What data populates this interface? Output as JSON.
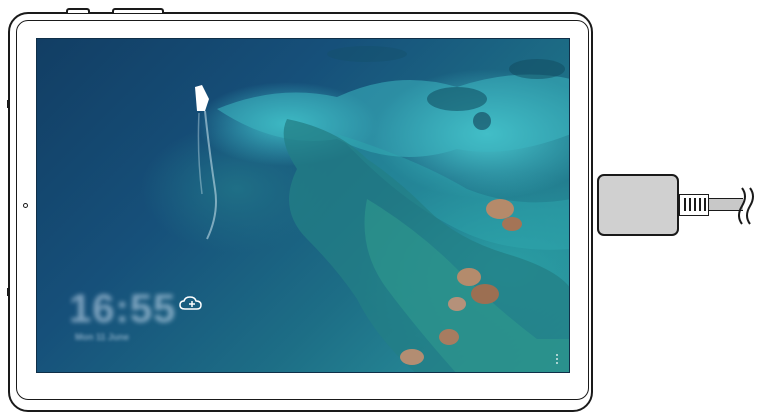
{
  "lock_screen": {
    "clock": "16:55",
    "date": "Mon 11 June",
    "cloud_icon": "cloud-add-icon",
    "menu_icon": "more-vertical-icon"
  },
  "device": {
    "type": "tablet",
    "accessory": "usb-charging-cable"
  },
  "colors": {
    "frame": "#1a1a1a",
    "deep_water": "#123e64",
    "shallow_water": "#49c8cf",
    "plug_fill": "#d0d0d0"
  }
}
